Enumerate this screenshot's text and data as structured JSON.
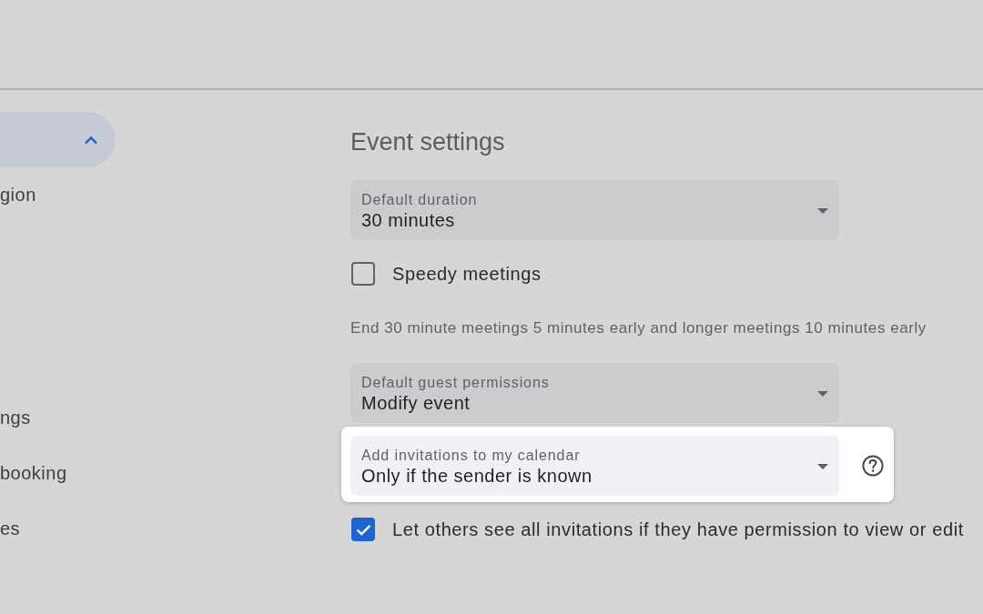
{
  "sidebar": {
    "section": {
      "expanded": true
    },
    "items": [
      {
        "label": "gion"
      },
      {
        "label": "ngs"
      },
      {
        "label": "booking"
      },
      {
        "label": "es"
      }
    ]
  },
  "main": {
    "title": "Event settings",
    "settings": [
      {
        "kind": "select",
        "label": "Default duration",
        "value": "30 minutes",
        "highlighted": false
      },
      {
        "kind": "checkbox",
        "label": "Speedy meetings",
        "checked": false
      },
      {
        "kind": "hint",
        "text": "End 30 minute meetings 5 minutes early and longer meetings 10 minutes early"
      },
      {
        "kind": "select",
        "label": "Default guest permissions",
        "value": "Modify event",
        "highlighted": false
      },
      {
        "kind": "select",
        "label": "Add invitations to my calendar",
        "value": "Only if the sender is known",
        "highlighted": true,
        "help": true
      },
      {
        "kind": "checkbox",
        "label": "Let others see all invitations if they have permission to view or edit",
        "checked": true
      }
    ]
  }
}
